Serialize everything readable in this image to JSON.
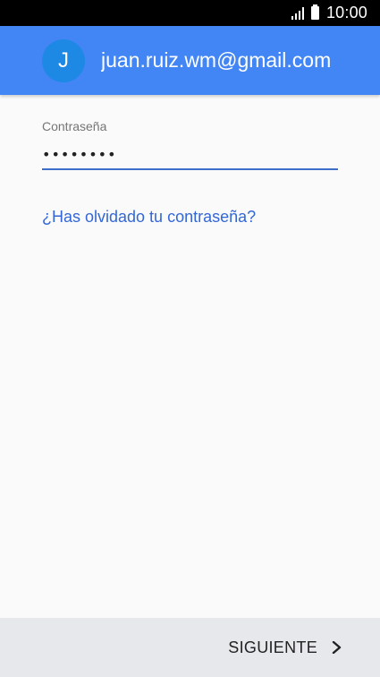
{
  "status_bar": {
    "time": "10:00",
    "signal_icon": "signal-icon",
    "battery_icon": "battery-icon"
  },
  "header": {
    "avatar_letter": "J",
    "account_email": "juan.ruiz.wm@gmail.com",
    "background": "#4285f4"
  },
  "form": {
    "password_label": "Contraseña",
    "password_value": "••••••••",
    "forgot_link": "¿Has olvidado tu contraseña?"
  },
  "footer": {
    "next_label": "SIGUIENTE",
    "next_icon": "chevron-right-icon"
  }
}
